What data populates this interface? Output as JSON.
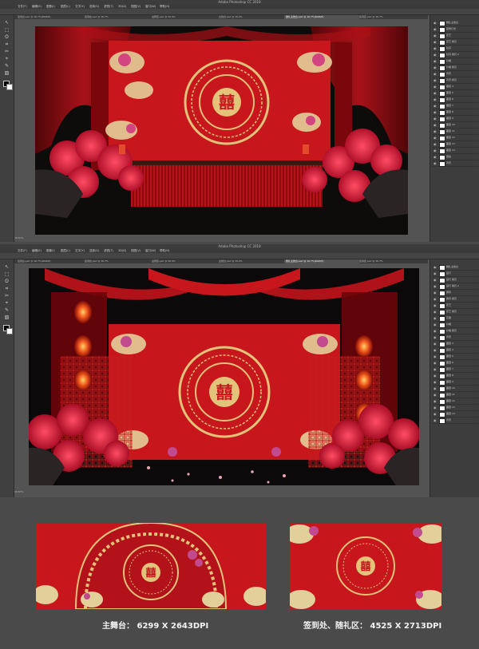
{
  "app": {
    "title": "Adobe Photoshop CC 2018",
    "menu": [
      "文件(F)",
      "编辑(E)",
      "图像(I)",
      "图层(L)",
      "文字(Y)",
      "选择(S)",
      "滤镜(T)",
      "3D(D)",
      "视图(V)",
      "窗口(W)",
      "帮助(H)"
    ],
    "tools": [
      "↖",
      "⬚",
      "ʘ",
      "⌗",
      "✂",
      "⌖",
      "✎",
      "▧",
      "◐",
      "T",
      "↗",
      "▭",
      "✋",
      "⌕"
    ]
  },
  "window1": {
    "tabs": [
      "签到台.psd @ 16.7%(RGB/8)",
      "签到处.psd @ 16.7%",
      "迎宾区.psd @ 50.9%",
      "主舞台.psd @ 10.9%",
      "婚礼主舞台.psd @ 16.7%(RGB/8)",
      "签到区.psd @ 16.7%"
    ],
    "active_tab": 4,
    "status": "16.67%",
    "layers": [
      "婚礼主舞台",
      "装饰灯光",
      "花艺",
      "花艺 拷贝",
      "牡丹",
      "牡丹 拷贝 2",
      "纱幔",
      "纱幔 拷贝",
      "背景",
      "背景 拷贝",
      "图层 4",
      "图层 5",
      "图层 6",
      "图层 7",
      "图层 8",
      "图层 9",
      "图层 10",
      "图层 11",
      "图层 12",
      "图层 13",
      "图层 14",
      "底纹",
      "背景"
    ]
  },
  "window2": {
    "tabs": [
      "签到台.psd @ 16.7%(RGB/8)",
      "签到处.psd @ 16.7%",
      "迎宾区.psd @ 50.9%",
      "主舞台.psd @ 10.9%",
      "婚礼主舞台.psd @ 16.7%(RGB/8)",
      "签到区.psd @ 16.7%"
    ],
    "active_tab": 4,
    "status": "16.67%",
    "layers": [
      "婚礼主舞台",
      "宫灯",
      "宫灯 拷贝",
      "宫灯 拷贝 2",
      "屏风",
      "屏风 拷贝",
      "花艺",
      "花艺 拷贝",
      "花瓣",
      "纱幔",
      "纱幔 拷贝",
      "背景",
      "图层 3",
      "图层 4",
      "图层 5",
      "图层 6",
      "图层 7",
      "图层 8",
      "图层 9",
      "图层 10",
      "图层 11",
      "图层 12",
      "图层 13",
      "图层 14",
      "背景"
    ]
  },
  "bottom": {
    "main_stage_caption": "主舞台： 6299 X 2643DPI",
    "signin_caption": "签到处、随礼区： 4525 X 2713DPI"
  },
  "colors": {
    "accent": "#c8161d",
    "gold": "#e3c27a",
    "dark": "#0e0b0b"
  }
}
